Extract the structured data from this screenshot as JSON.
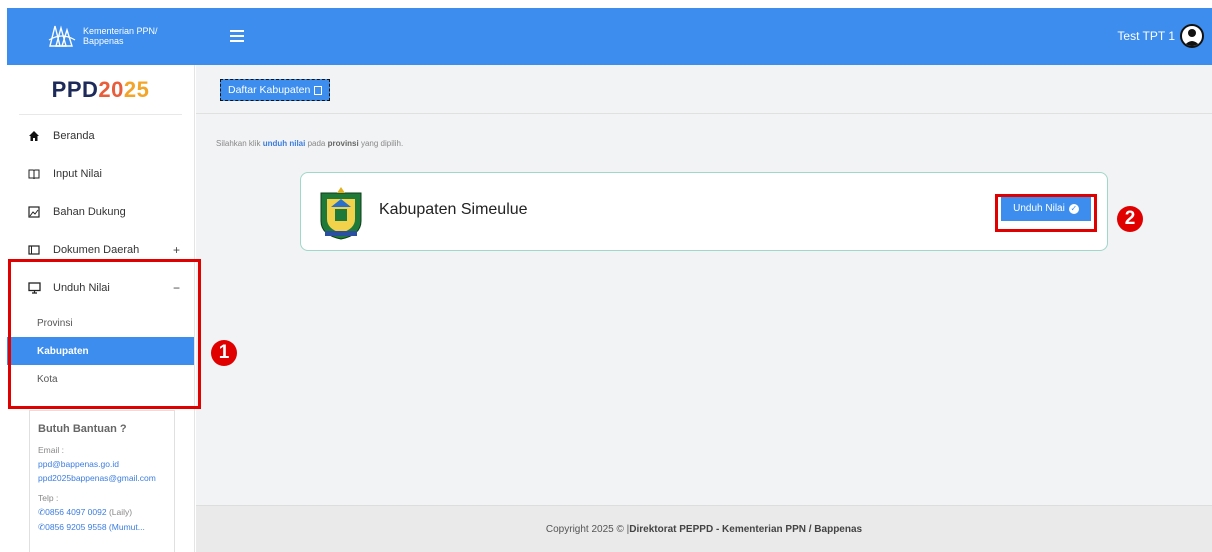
{
  "header": {
    "org_line1": "Kementerian PPN/",
    "org_line2": "Bappenas",
    "user_name": "Test TPT 1",
    "accent_color": "#3c8dee"
  },
  "sidebar": {
    "app_title_a": "PPD",
    "app_title_b": "20",
    "app_title_c": "25",
    "items": [
      {
        "label": "Beranda",
        "icon": "home-icon"
      },
      {
        "label": "Input Nilai",
        "icon": "book-icon"
      },
      {
        "label": "Bahan Dukung",
        "icon": "image-icon"
      },
      {
        "label": "Dokumen Daerah",
        "icon": "window-icon",
        "expand": "+"
      },
      {
        "label": "Unduh Nilai",
        "icon": "monitor-icon",
        "expand": "−"
      }
    ],
    "submenu": [
      {
        "label": "Provinsi"
      },
      {
        "label": "Kabupaten"
      },
      {
        "label": "Kota"
      }
    ],
    "help": {
      "title": "Butuh Bantuan ?",
      "email_label": "Email :",
      "email1": "ppd@bappenas.go.id",
      "email2": "ppd2025bappenas@gmail.com",
      "phone_label": "Telp :",
      "phone1": "✆0856 4097 0092",
      "phone1_name": "(Laily)",
      "phone2": "✆0856 9205 9558 (Mumut..."
    }
  },
  "main": {
    "breadcrumb": "Daftar Kabupaten",
    "hint_prefix": "Silahkan klik ",
    "hint_link": "unduh nilai",
    "hint_mid": " pada ",
    "hint_strong": "provinsi",
    "hint_suffix": " yang dipilih.",
    "card_title": "Kabupaten Simeulue",
    "download_label": "Unduh Nilai",
    "footer_prefix": "Copyright 2025 © |",
    "footer_bold": "Direktorat PEPPD - Kementerian PPN / Bappenas"
  },
  "annotations": {
    "step1": "1",
    "step2": "2"
  }
}
